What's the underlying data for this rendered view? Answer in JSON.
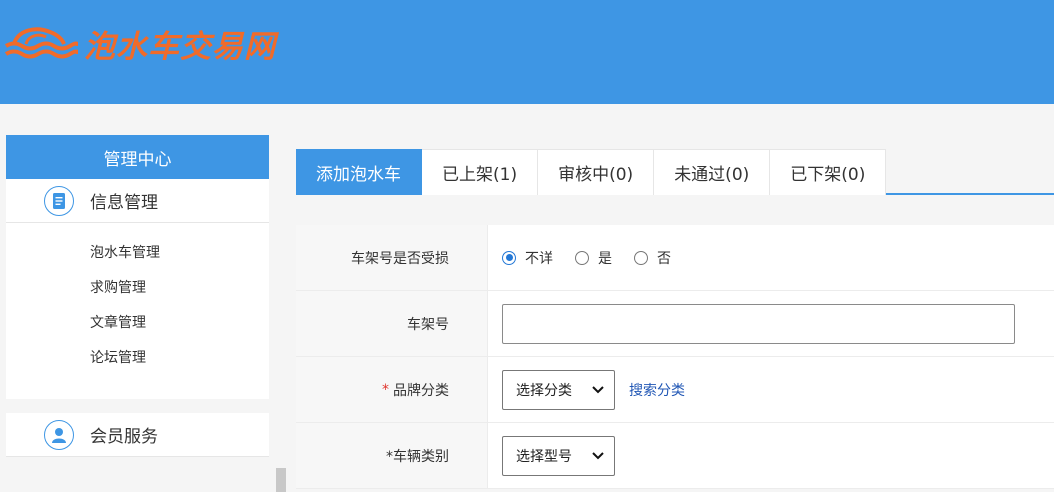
{
  "header": {
    "logo_text": "泡水车交易网",
    "logo_color": "#f06b2a",
    "bg_color": "#3e96e4"
  },
  "sidebar": {
    "title": "管理中心",
    "sections": [
      {
        "title": "信息管理",
        "icon": "document-icon",
        "items": [
          "泡水车管理",
          "求购管理",
          "文章管理",
          "论坛管理"
        ]
      },
      {
        "title": "会员服务",
        "icon": "user-icon"
      }
    ]
  },
  "tabs": [
    {
      "label": "添加泡水车",
      "active": true
    },
    {
      "label": "已上架(1)"
    },
    {
      "label": "审核中(0)"
    },
    {
      "label": "未通过(0)"
    },
    {
      "label": "已下架(0)"
    }
  ],
  "form": {
    "damage": {
      "label": "车架号是否受损",
      "options": [
        "不详",
        "是",
        "否"
      ],
      "selected": "不详"
    },
    "vin": {
      "label": "车架号",
      "value": ""
    },
    "brand": {
      "required_mark": "*",
      "label": "品牌分类",
      "select": "选择分类",
      "link": "搜索分类"
    },
    "type": {
      "label": "*车辆类别",
      "select": "选择型号"
    }
  }
}
